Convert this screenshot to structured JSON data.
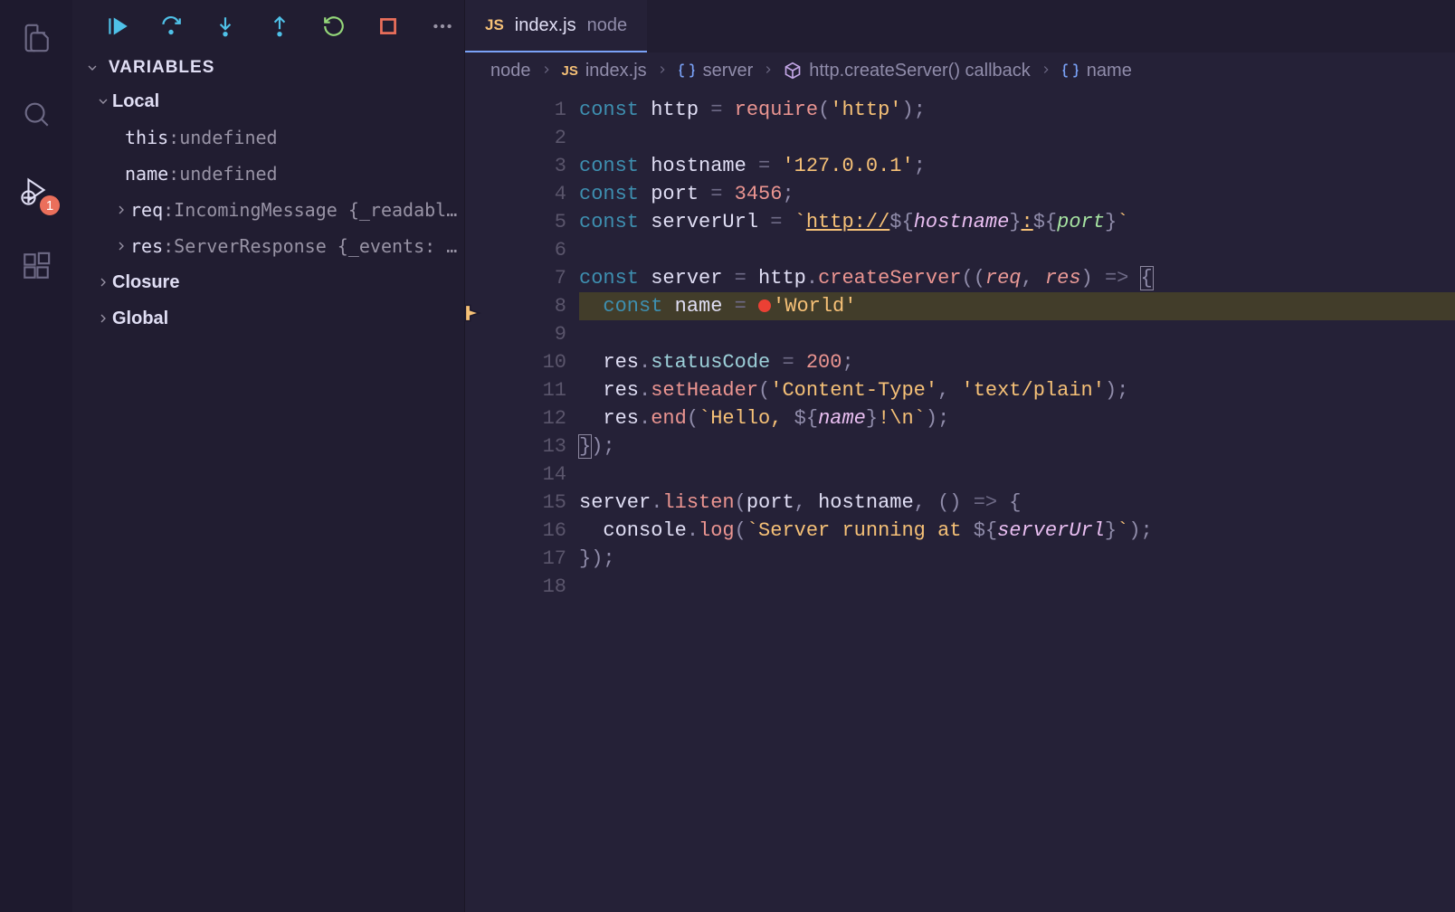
{
  "activity": {
    "debug_badge": "1"
  },
  "debugToolbar": {
    "continue": "Continue",
    "stepOver": "Step Over",
    "stepInto": "Step Into",
    "stepOut": "Step Out",
    "restart": "Restart",
    "stop": "Stop",
    "more": "More Actions"
  },
  "variables": {
    "title": "VARIABLES",
    "scopes": {
      "local": {
        "label": "Local",
        "items": [
          {
            "key": "this",
            "value": "undefined",
            "expandable": false
          },
          {
            "key": "name",
            "value": "undefined",
            "expandable": false
          },
          {
            "key": "req",
            "value": "IncomingMessage {_readabl…",
            "expandable": true
          },
          {
            "key": "res",
            "value": "ServerResponse {_events: …",
            "expandable": true
          }
        ]
      },
      "closure": {
        "label": "Closure"
      },
      "global": {
        "label": "Global"
      }
    }
  },
  "tab": {
    "icon": "JS",
    "fileName": "index.js",
    "desc": "node"
  },
  "breadcrumbs": [
    {
      "label": "node",
      "icon": null
    },
    {
      "label": "index.js",
      "icon": "js"
    },
    {
      "label": "server",
      "icon": "bracket-blue"
    },
    {
      "label": "http.createServer() callback",
      "icon": "cube-purple"
    },
    {
      "label": "name",
      "icon": "bracket-blue"
    }
  ],
  "code": {
    "currentLine": 8,
    "lines": [
      {
        "n": 1,
        "tokens": [
          [
            "kw",
            "const"
          ],
          [
            "op",
            " "
          ],
          [
            "ident",
            "http"
          ],
          [
            "op",
            " "
          ],
          [
            "op",
            "="
          ],
          [
            "op",
            " "
          ],
          [
            "fn",
            "require"
          ],
          [
            "punc",
            "("
          ],
          [
            "str",
            "'http'"
          ],
          [
            "punc",
            ")"
          ],
          [
            "punc",
            ";"
          ]
        ]
      },
      {
        "n": 2,
        "tokens": []
      },
      {
        "n": 3,
        "tokens": [
          [
            "kw",
            "const"
          ],
          [
            "op",
            " "
          ],
          [
            "ident",
            "hostname"
          ],
          [
            "op",
            " "
          ],
          [
            "op",
            "="
          ],
          [
            "op",
            " "
          ],
          [
            "str",
            "'127.0.0.1'"
          ],
          [
            "punc",
            ";"
          ]
        ]
      },
      {
        "n": 4,
        "tokens": [
          [
            "kw",
            "const"
          ],
          [
            "op",
            " "
          ],
          [
            "ident",
            "port"
          ],
          [
            "op",
            " "
          ],
          [
            "op",
            "="
          ],
          [
            "op",
            " "
          ],
          [
            "num",
            "3456"
          ],
          [
            "punc",
            ";"
          ]
        ]
      },
      {
        "n": 5,
        "tokens": [
          [
            "kw",
            "const"
          ],
          [
            "op",
            " "
          ],
          [
            "ident",
            "serverUrl"
          ],
          [
            "op",
            " "
          ],
          [
            "op",
            "="
          ],
          [
            "op",
            " "
          ],
          [
            "str",
            "`"
          ],
          [
            "url",
            "http://"
          ],
          [
            "punc",
            "${"
          ],
          [
            "tpl-id",
            "hostname"
          ],
          [
            "punc",
            "}"
          ],
          [
            "url",
            ":"
          ],
          [
            "punc",
            "${"
          ],
          [
            "tpl-id2",
            "port"
          ],
          [
            "punc",
            "}"
          ],
          [
            "str",
            "`"
          ]
        ]
      },
      {
        "n": 6,
        "tokens": []
      },
      {
        "n": 7,
        "tokens": [
          [
            "kw",
            "const"
          ],
          [
            "op",
            " "
          ],
          [
            "ident",
            "server"
          ],
          [
            "op",
            " "
          ],
          [
            "op",
            "="
          ],
          [
            "op",
            " "
          ],
          [
            "ident",
            "http"
          ],
          [
            "punc",
            "."
          ],
          [
            "fn",
            "createServer"
          ],
          [
            "punc",
            "(("
          ],
          [
            "param",
            "req"
          ],
          [
            "punc",
            ", "
          ],
          [
            "param",
            "res"
          ],
          [
            "punc",
            ") "
          ],
          [
            "arrow",
            "=>"
          ],
          [
            "punc",
            " "
          ],
          [
            "bracket-open",
            "{"
          ]
        ]
      },
      {
        "n": 8,
        "tokens": [
          [
            "op",
            "  "
          ],
          [
            "kw",
            "const"
          ],
          [
            "op",
            " "
          ],
          [
            "ident",
            "name"
          ],
          [
            "op",
            " "
          ],
          [
            "op",
            "="
          ],
          [
            "op",
            " "
          ],
          [
            "bp",
            ""
          ],
          [
            "str",
            "'World'"
          ]
        ]
      },
      {
        "n": 9,
        "tokens": []
      },
      {
        "n": 10,
        "tokens": [
          [
            "op",
            "  "
          ],
          [
            "ident",
            "res"
          ],
          [
            "punc",
            "."
          ],
          [
            "prop",
            "statusCode"
          ],
          [
            "op",
            " "
          ],
          [
            "op",
            "="
          ],
          [
            "op",
            " "
          ],
          [
            "num",
            "200"
          ],
          [
            "punc",
            ";"
          ]
        ]
      },
      {
        "n": 11,
        "tokens": [
          [
            "op",
            "  "
          ],
          [
            "ident",
            "res"
          ],
          [
            "punc",
            "."
          ],
          [
            "fn",
            "setHeader"
          ],
          [
            "punc",
            "("
          ],
          [
            "str",
            "'Content-Type'"
          ],
          [
            "punc",
            ", "
          ],
          [
            "str",
            "'text/plain'"
          ],
          [
            "punc",
            ");"
          ]
        ]
      },
      {
        "n": 12,
        "tokens": [
          [
            "op",
            "  "
          ],
          [
            "ident",
            "res"
          ],
          [
            "punc",
            "."
          ],
          [
            "fn",
            "end"
          ],
          [
            "punc",
            "("
          ],
          [
            "str",
            "`Hello, "
          ],
          [
            "punc",
            "${"
          ],
          [
            "tpl-id",
            "name"
          ],
          [
            "punc",
            "}"
          ],
          [
            "str",
            "!\\n`"
          ],
          [
            "punc",
            ");"
          ]
        ]
      },
      {
        "n": 13,
        "tokens": [
          [
            "bracket-close",
            "}"
          ],
          [
            "punc",
            ");"
          ]
        ]
      },
      {
        "n": 14,
        "tokens": []
      },
      {
        "n": 15,
        "tokens": [
          [
            "ident",
            "server"
          ],
          [
            "punc",
            "."
          ],
          [
            "fn",
            "listen"
          ],
          [
            "punc",
            "("
          ],
          [
            "ident",
            "port"
          ],
          [
            "punc",
            ", "
          ],
          [
            "ident",
            "hostname"
          ],
          [
            "punc",
            ", () "
          ],
          [
            "arrow",
            "=>"
          ],
          [
            "punc",
            " {"
          ]
        ]
      },
      {
        "n": 16,
        "tokens": [
          [
            "op",
            "  "
          ],
          [
            "ident",
            "console"
          ],
          [
            "punc",
            "."
          ],
          [
            "fn",
            "log"
          ],
          [
            "punc",
            "("
          ],
          [
            "str",
            "`Server running at "
          ],
          [
            "punc",
            "${"
          ],
          [
            "tpl-id",
            "serverUrl"
          ],
          [
            "punc",
            "}"
          ],
          [
            "str",
            "`"
          ],
          [
            "punc",
            ");"
          ]
        ]
      },
      {
        "n": 17,
        "tokens": [
          [
            "punc",
            "});"
          ]
        ]
      },
      {
        "n": 18,
        "tokens": []
      }
    ]
  }
}
